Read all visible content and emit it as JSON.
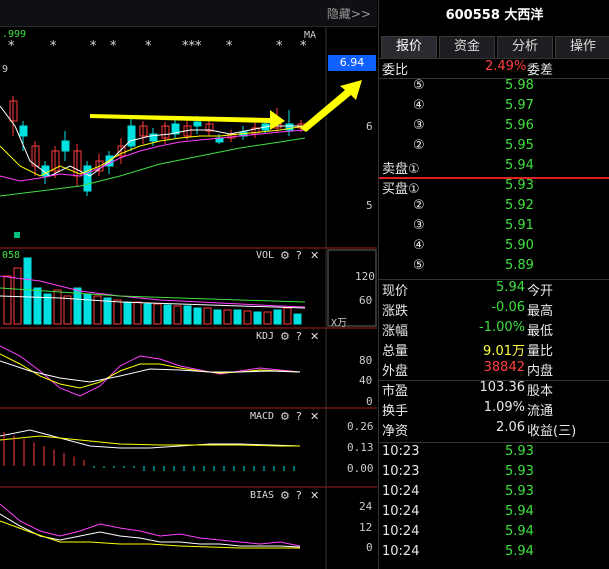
{
  "chart": {
    "hide_label": "隐藏>>",
    "ma_label": "MA",
    "price_highlight": "6.94",
    "price_axis": [
      "6",
      "5"
    ],
    "partial_top_left": ".999",
    "partial_mid_left": "9",
    "stars": [
      "*",
      "*",
      "*",
      "*",
      "*",
      "***",
      "*",
      "*",
      "*"
    ],
    "vol": {
      "title": "VOL",
      "partial_left": "058",
      "axis": [
        "120",
        "60"
      ],
      "unit": "X万"
    },
    "kdj": {
      "title": "KDJ",
      "axis": [
        "80",
        "40",
        "0"
      ]
    },
    "macd": {
      "title": "MACD",
      "axis": [
        "0.26",
        "0.13",
        "0.00"
      ]
    },
    "bias": {
      "title": "BIAS",
      "axis": [
        "24",
        "12",
        "0"
      ]
    },
    "icons": {
      "settings": "gear-icon",
      "help": "question-icon",
      "close": "close-icon"
    },
    "colors": {
      "up": "#ff3c3c",
      "down": "#00e0e0",
      "ma_white": "#ffffff",
      "ma_yellow": "#ffff00",
      "ma_magenta": "#ff40ff",
      "ma_green": "#40e040",
      "arrow": "#ffff00"
    }
  },
  "panel": {
    "title": "600558 大西洋",
    "tabs": [
      "报价",
      "资金",
      "分析",
      "操作"
    ],
    "weibi_label": "委比",
    "weibi_value": "2.49%",
    "weicha_label": "委差",
    "sell": [
      {
        "label": "⑤",
        "price": "5.98"
      },
      {
        "label": "④",
        "price": "5.97"
      },
      {
        "label": "③",
        "price": "5.96"
      },
      {
        "label": "②",
        "price": "5.95"
      },
      {
        "label": "卖盘①",
        "price": "5.94"
      }
    ],
    "buy": [
      {
        "label": "买盘①",
        "price": "5.93"
      },
      {
        "label": "②",
        "price": "5.92"
      },
      {
        "label": "③",
        "price": "5.91"
      },
      {
        "label": "④",
        "price": "5.90"
      },
      {
        "label": "⑤",
        "price": "5.89"
      }
    ],
    "stats": [
      {
        "l1": "现价",
        "v1": "5.94",
        "c1": "green",
        "l2": "今开"
      },
      {
        "l1": "涨跌",
        "v1": "-0.06",
        "c1": "green",
        "l2": "最高"
      },
      {
        "l1": "涨幅",
        "v1": "-1.00%",
        "c1": "green",
        "l2": "最低"
      },
      {
        "l1": "总量",
        "v1": "9.01万",
        "c1": "yellow",
        "l2": "量比"
      },
      {
        "l1": "外盘",
        "v1": "38842",
        "c1": "red",
        "l2": "内盘"
      }
    ],
    "stats2": [
      {
        "l1": "市盈",
        "v1": "103.36",
        "l2": "股本"
      },
      {
        "l1": "换手",
        "v1": "1.09%",
        "l2": "流通"
      },
      {
        "l1": "净资",
        "v1": "2.06",
        "l2": "收益(三)"
      }
    ],
    "ticks": [
      {
        "time": "10:23",
        "price": "5.93"
      },
      {
        "time": "10:23",
        "price": "5.93"
      },
      {
        "time": "10:24",
        "price": "5.93"
      },
      {
        "time": "10:24",
        "price": "5.94"
      },
      {
        "time": "10:24",
        "price": "5.94"
      },
      {
        "time": "10:24",
        "price": "5.94"
      }
    ]
  }
}
